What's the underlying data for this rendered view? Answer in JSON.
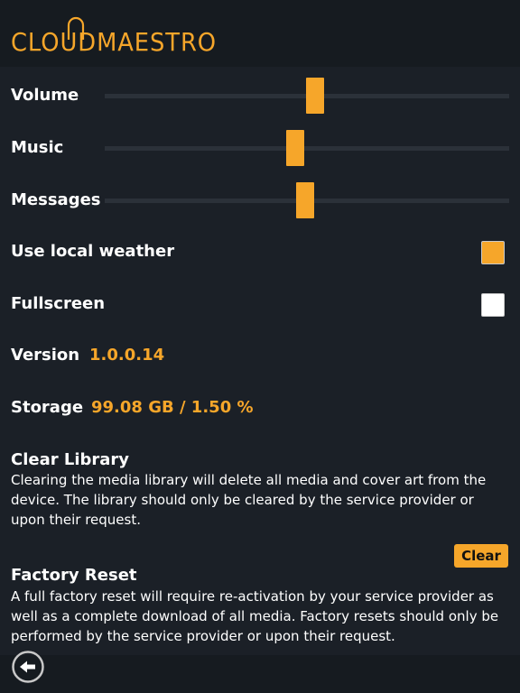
{
  "header": {
    "logo_text": "CLOUDMAESTRO",
    "brand_color": "#f6a62a"
  },
  "settings": {
    "volume": {
      "label": "Volume",
      "value_fraction": 0.52
    },
    "music": {
      "label": "Music",
      "value_fraction": 0.47
    },
    "messages": {
      "label": "Messages",
      "value_fraction": 0.495
    },
    "use_local_weather": {
      "label": "Use local weather",
      "checked": true
    },
    "fullscreen": {
      "label": "Fullscreen",
      "checked": false
    },
    "version": {
      "label": "Version",
      "value": "1.0.0.14"
    },
    "storage": {
      "label": "Storage",
      "value": "99.08 GB / 1.50 %"
    },
    "clear_library": {
      "title": "Clear Library",
      "description": "Clearing the media library will delete all media and cover art from the device. The library should only be cleared by the service provider or upon their request.",
      "button_label": "Clear"
    },
    "factory_reset": {
      "title": "Factory Reset",
      "description": "A full factory reset will require re-activation by your service provider as well as a complete download of all media. Factory resets should only be performed by the service provider or upon their request."
    }
  },
  "footer": {
    "back_icon": "back-arrow-icon"
  },
  "colors": {
    "accent": "#f6a62a",
    "background": "#1b2027",
    "header_background": "#161b20",
    "track": "#2b3139"
  }
}
